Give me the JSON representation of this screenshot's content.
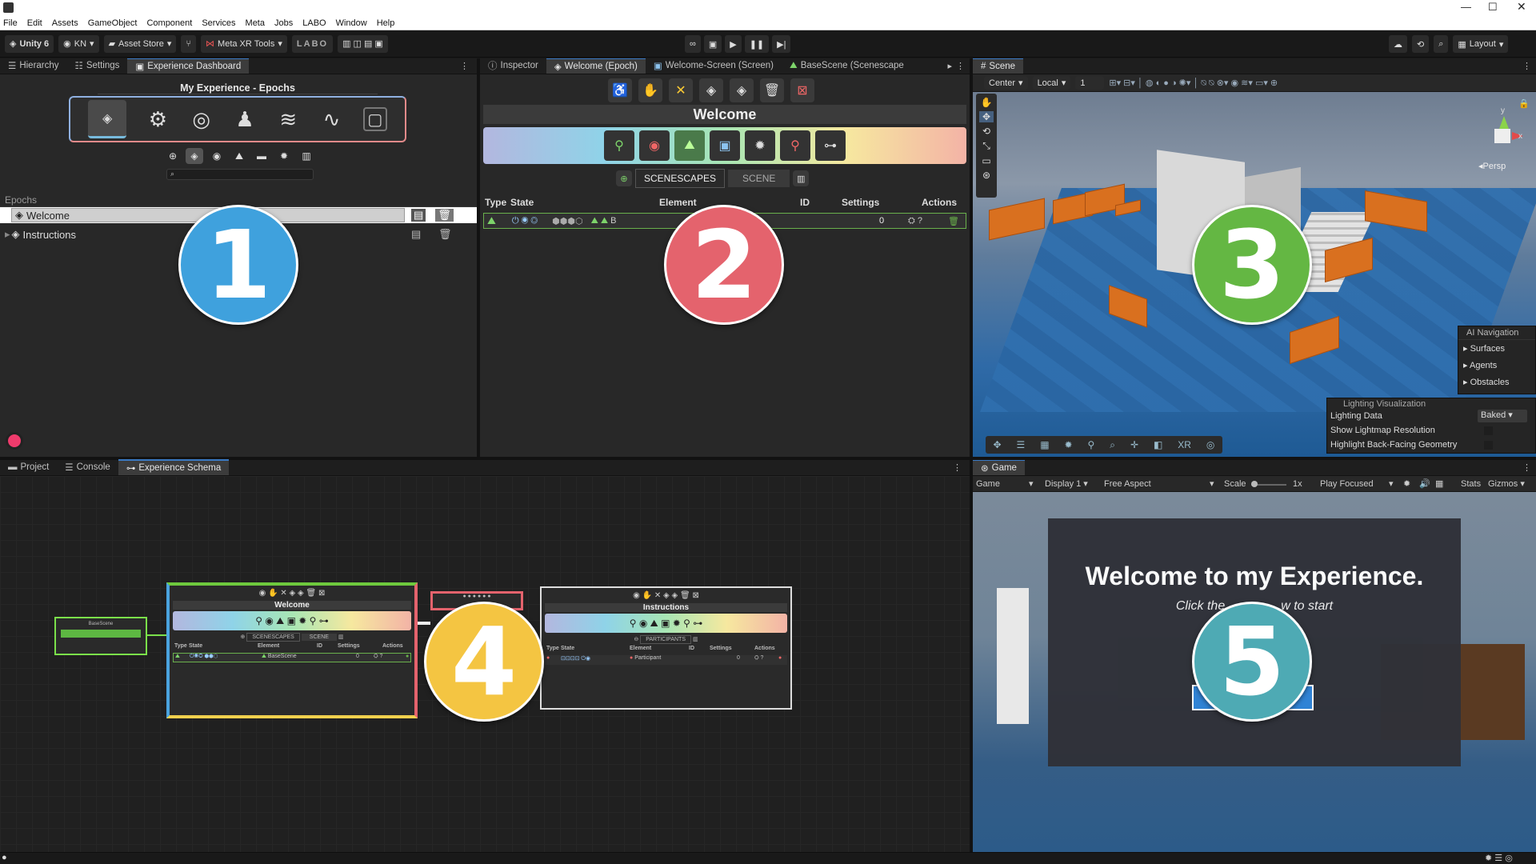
{
  "menu": [
    "File",
    "Edit",
    "Assets",
    "GameObject",
    "Component",
    "Services",
    "Meta",
    "Jobs",
    "LABO",
    "Window",
    "Help"
  ],
  "toolbar": {
    "unity": "Unity 6",
    "account": "KN",
    "asset_store": "Asset Store",
    "meta_xr": "Meta XR Tools",
    "labo": "LABO",
    "layout": "Layout"
  },
  "left_tabs": [
    "Hierarchy",
    "Settings",
    "Experience Dashboard"
  ],
  "dashboard": {
    "title": "My Experience - Epochs",
    "section": "Epochs",
    "items": [
      "Welcome",
      "Instructions"
    ]
  },
  "inspector_tabs": [
    "Inspector",
    "Welcome (Epoch)",
    "Welcome-Screen (Screen)",
    "BaseScene (Scenescape"
  ],
  "inspector": {
    "title": "Welcome",
    "tab_scenescapes": "SCENESCAPES",
    "tab_scene": "SCENE",
    "columns": [
      "Type",
      "State",
      "Element",
      "ID",
      "Settings",
      "Actions"
    ],
    "row_element": "B",
    "row_settings": "0"
  },
  "scene": {
    "tab": "Scene",
    "pivot": "Center",
    "space": "Local",
    "grid": "1",
    "persp": "Persp",
    "axis_y": "y",
    "axis_x": "x",
    "ai_nav": {
      "title": "AI Navigation",
      "items": [
        "Surfaces",
        "Agents",
        "Obstacles"
      ]
    },
    "lighting": {
      "title": "Lighting Visualization",
      "rows": [
        "Lighting Data",
        "Show Lightmap Resolution",
        "Highlight Back-Facing Geometry"
      ],
      "value": "Baked"
    }
  },
  "bottom_tabs": [
    "Project",
    "Console",
    "Experience Schema"
  ],
  "schema": {
    "node1": "Welcome",
    "node1_tab1": "SCENESCAPES",
    "node1_tab2": "SCENE",
    "node1_cols": [
      "Type",
      "State",
      "Element",
      "ID",
      "Settings",
      "Actions"
    ],
    "node1_element": "BaseScene",
    "node1_settings": "0",
    "node2": "Instructions",
    "node2_tab": "PARTICIPANTS",
    "node2_cols": [
      "Type",
      "State",
      "Element",
      "ID",
      "Settings",
      "Actions"
    ],
    "node2_element": "Participant",
    "node2_settings": "0",
    "start_node": "BaseScene"
  },
  "game": {
    "tab": "Game",
    "mode": "Game",
    "display": "Display 1",
    "aspect": "Free Aspect",
    "scale_label": "Scale",
    "scale_value": "1x",
    "play": "Play Focused",
    "stats": "Stats",
    "gizmos": "Gizmos",
    "welcome_text": "Welcome to my Experience.",
    "sub_left": "Click the",
    "sub_right": "w to start"
  },
  "callouts": [
    {
      "label": "1",
      "color": "#3fa1dd"
    },
    {
      "label": "2",
      "color": "#e4636d"
    },
    {
      "label": "3",
      "color": "#64b743"
    },
    {
      "label": "4",
      "color": "#f4c542"
    },
    {
      "label": "5",
      "color": "#4eaab4"
    }
  ]
}
